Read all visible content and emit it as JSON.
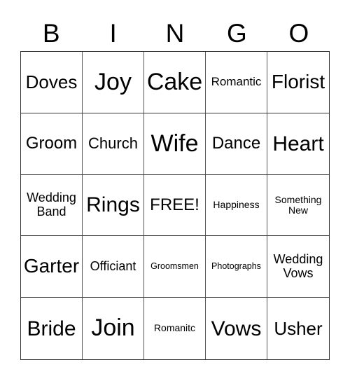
{
  "header": [
    "B",
    "I",
    "N",
    "G",
    "O"
  ],
  "cells": [
    "Doves",
    "Joy",
    "Cake",
    "Romantic",
    "Florist",
    "Groom",
    "Church",
    "Wife",
    "Dance",
    "Heart",
    "Wedding Band",
    "Rings",
    "FREE!",
    "Happiness",
    "Something New",
    "Garter",
    "Officiant",
    "Groomsmen",
    "Photographs",
    "Wedding Vows",
    "Bride",
    "Join",
    "Romanitc",
    "Vows",
    "Usher"
  ]
}
